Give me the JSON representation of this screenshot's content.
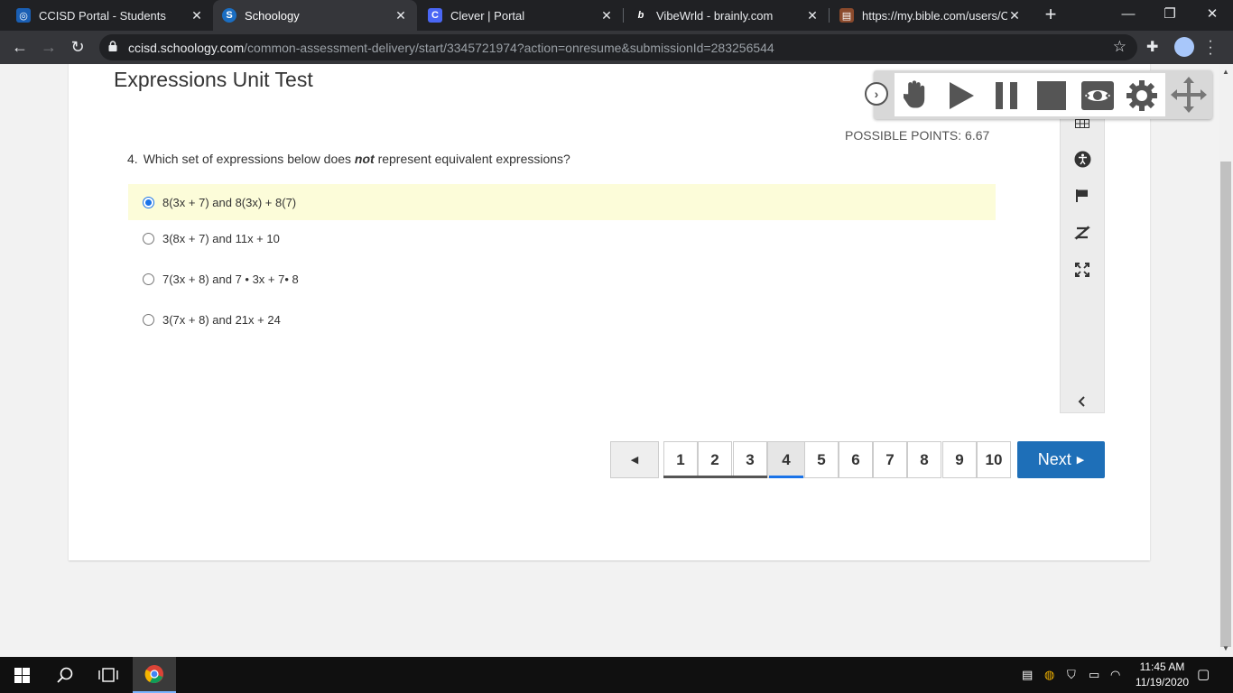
{
  "browser": {
    "tabs": [
      {
        "title": "CCISD Portal - Students",
        "favicon_color": "#1a5fb4",
        "favicon_letter": "◎"
      },
      {
        "title": "Schoology",
        "favicon_color": "#1b6ec2",
        "favicon_letter": "S",
        "active": true
      },
      {
        "title": "Clever | Portal",
        "favicon_color": "#4a67f5",
        "favicon_letter": "C"
      },
      {
        "title": "VibeWrld - brainly.com",
        "favicon_color": "#202124",
        "favicon_letter": "b"
      },
      {
        "title": "https://my.bible.com/users/Ca",
        "favicon_color": "#8b4a2c",
        "favicon_letter": "▤"
      }
    ],
    "address": {
      "host": "ccisd.schoology.com",
      "path": "/common-assessment-delivery/start/3345721974?action=onresume&submissionId=283256544"
    }
  },
  "test": {
    "title": "Expressions Unit Test",
    "possible_points": "POSSIBLE POINTS: 6.67",
    "question": {
      "number": "4.",
      "text_before": "Which set of expressions below does ",
      "text_emphasis": "not",
      "text_after": " represent equivalent expressions?"
    },
    "choices": [
      {
        "label": "8(3x + 7) and 8(3x) + 8(7)",
        "selected": true
      },
      {
        "label": "3(8x + 7) and 11x + 10",
        "selected": false
      },
      {
        "label": "7(3x + 8) and 7 • 3x + 7• 8",
        "selected": false
      },
      {
        "label": "3(7x + 8) and 21x + 24",
        "selected": false
      }
    ],
    "pager": {
      "pages": [
        "1",
        "2",
        "3",
        "4",
        "5",
        "6",
        "7",
        "8",
        "9",
        "10"
      ],
      "current": "4",
      "next_label": "Next"
    }
  },
  "tools": [
    "calculator-icon",
    "accessibility-icon",
    "flag-icon",
    "eliminate-choice-icon",
    "fullscreen-icon",
    "collapse-left-icon"
  ],
  "reader_toolbar": [
    "hand-pointer-icon",
    "play-icon",
    "pause-icon",
    "stop-icon",
    "screen-mask-icon",
    "settings-icon",
    "move-icon"
  ],
  "taskbar": {
    "time": "11:45 AM",
    "date": "11/19/2020"
  },
  "colors": {
    "accent_blue": "#1e6fb8",
    "selected_row": "#fcfcd9"
  }
}
